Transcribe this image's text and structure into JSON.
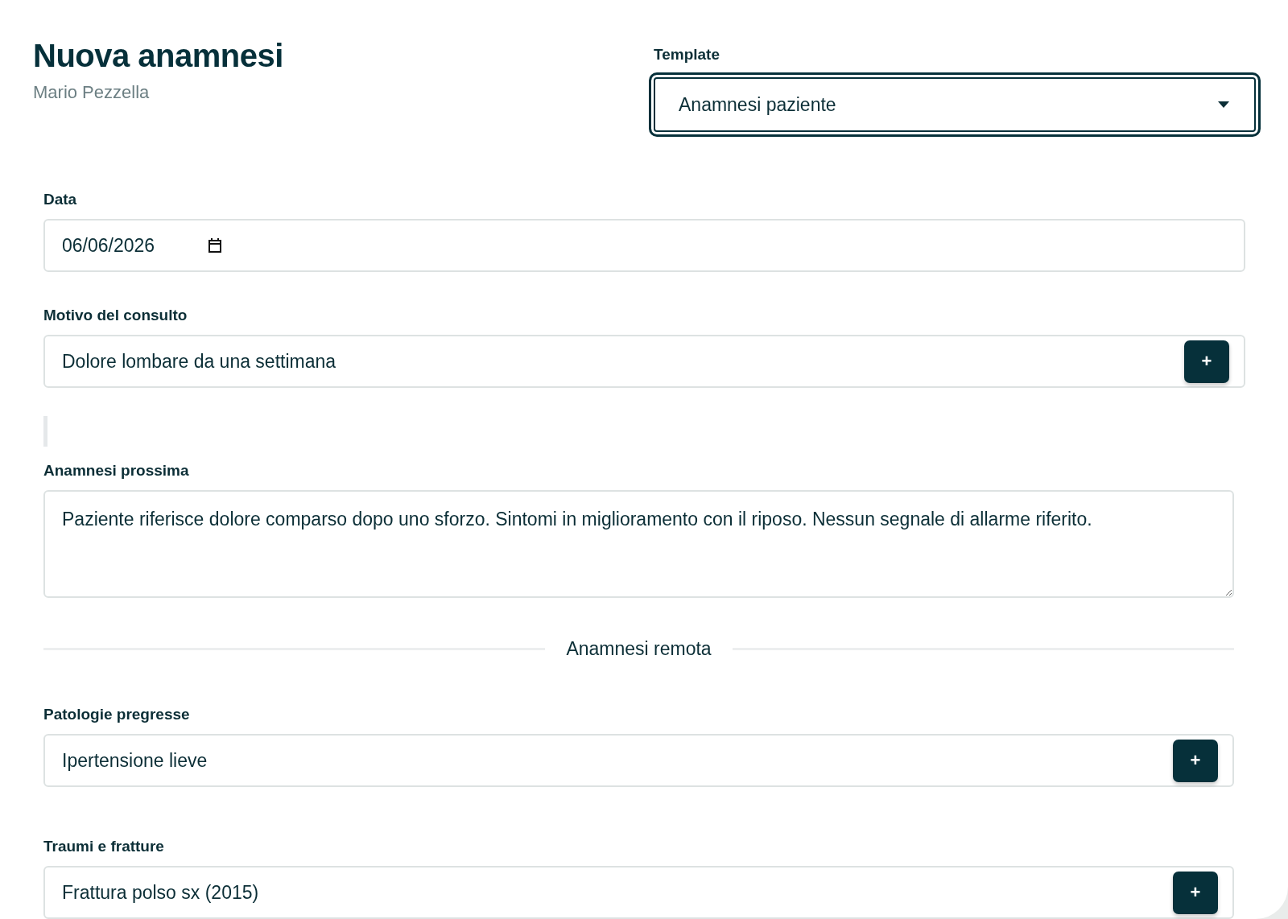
{
  "header": {
    "title": "Nuova anamnesi",
    "subtitle": "Mario Pezzella"
  },
  "template": {
    "label": "Template",
    "value": "Anamnesi paziente",
    "focused": true
  },
  "fields": [
    {
      "kind": "date",
      "label": "Data",
      "value": "06/06/2026"
    },
    {
      "kind": "add_input",
      "label": "Motivo del consulto",
      "value": "Dolore lombare da una settimana",
      "button": "+"
    },
    {
      "kind": "bar"
    },
    {
      "kind": "textarea",
      "label": "Anamnesi prossima",
      "value": "Paziente riferisce dolore comparso dopo uno sforzo. Sintomi in miglioramento con il riposo. Nessun segnale di allarme riferito."
    },
    {
      "kind": "divider",
      "label": "Anamnesi remota"
    },
    {
      "kind": "add_input",
      "label": "Patologie pregresse",
      "value": "Ipertensione lieve",
      "button": "+"
    },
    {
      "kind": "add_input",
      "label": "Traumi e fratture",
      "value": "Frattura polso sx (2015)",
      "button": "+"
    }
  ]
}
